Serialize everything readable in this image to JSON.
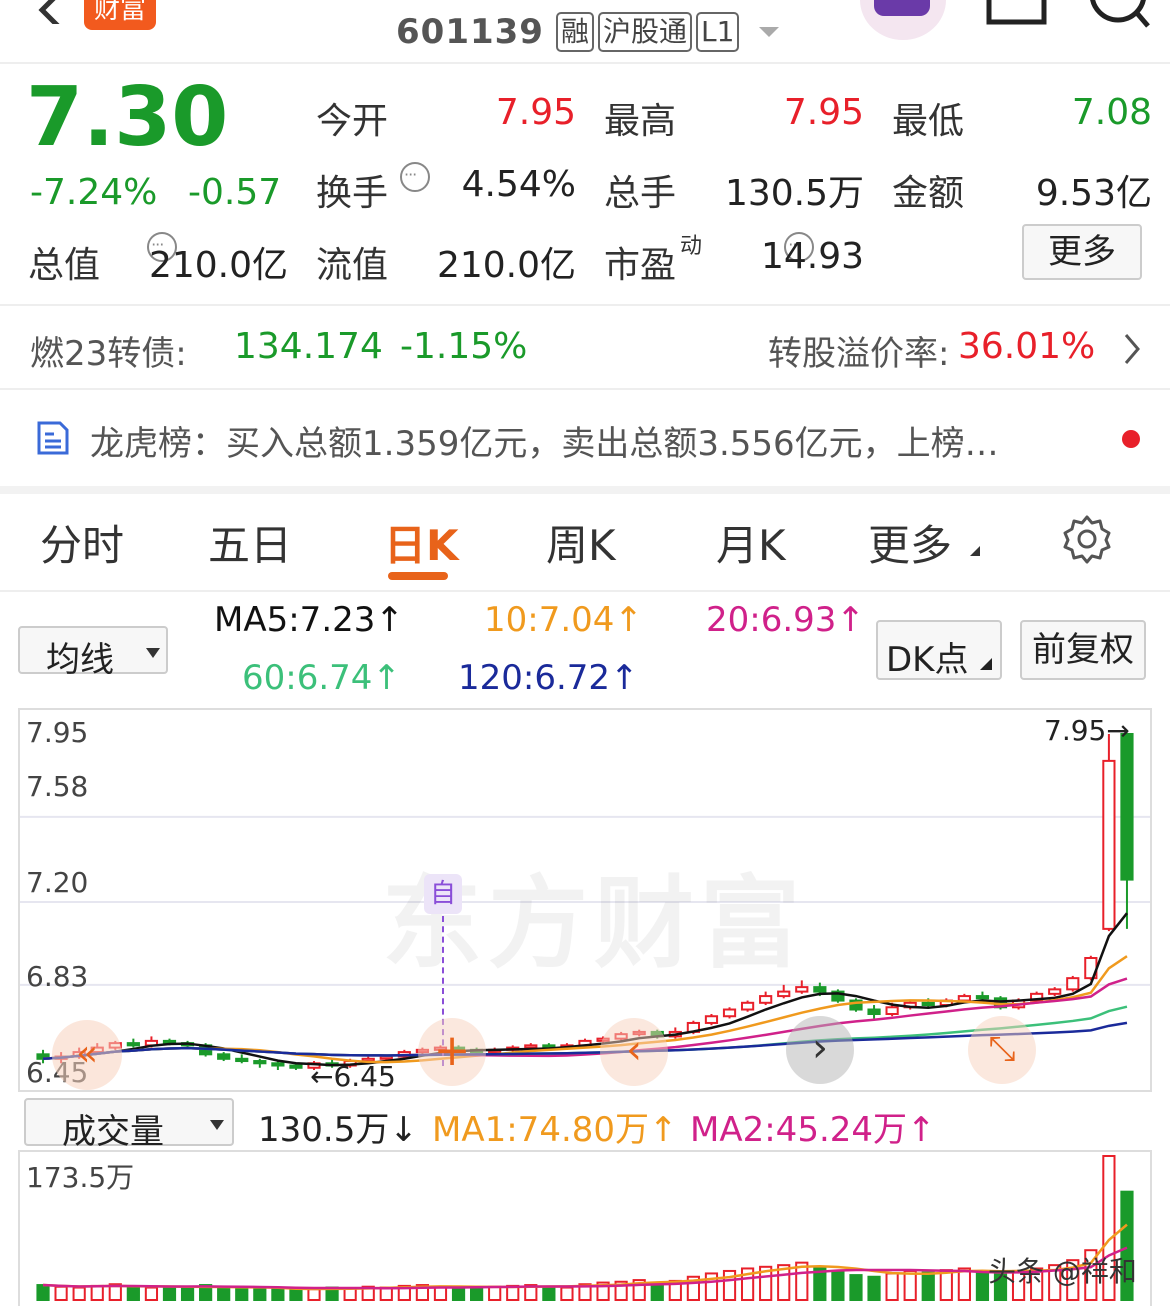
{
  "header": {
    "back_icon": "chevron-left-icon",
    "brand_badge": "财富",
    "stock_code": "601139",
    "tags": [
      "融",
      "沪股通",
      "L1"
    ],
    "dropdown_icon": "caret-down-icon",
    "share_icon": "share-icon",
    "search_icon": "search-icon"
  },
  "quote": {
    "price": "7.30",
    "change_pct": "-7.24%",
    "change_amt": "-0.57",
    "rows": [
      [
        {
          "label": "今开",
          "value": "7.95",
          "color": "red"
        },
        {
          "label": "最高",
          "value": "7.95",
          "color": "red"
        },
        {
          "label": "最低",
          "value": "7.08",
          "color": "green"
        }
      ],
      [
        {
          "label": "换手",
          "value": "4.54%",
          "color": "dark",
          "info": true
        },
        {
          "label": "总手",
          "value": "130.5万",
          "color": "dark"
        },
        {
          "label": "金额",
          "value": "9.53亿",
          "color": "dark"
        }
      ]
    ],
    "row3": {
      "mv_label": "总值",
      "mv_value": "210.0亿",
      "float_label": "流值",
      "float_value": "210.0亿",
      "pe_label": "市盈",
      "pe_sup": "动",
      "pe_value": "14.93",
      "more_button": "更多"
    }
  },
  "bond": {
    "name": "燃23转债:",
    "price": "134.174",
    "change": "-1.15%",
    "premium_label": "转股溢价率:",
    "premium_value": "36.01%"
  },
  "lhb": {
    "text": "龙虎榜：买入总额1.359亿元，卖出总额3.556亿元，上榜…"
  },
  "tabs": [
    {
      "label": "分时",
      "active": false
    },
    {
      "label": "五日",
      "active": false
    },
    {
      "label": "日K",
      "active": true
    },
    {
      "label": "周K",
      "active": false
    },
    {
      "label": "月K",
      "active": false
    },
    {
      "label": "更多",
      "active": false
    }
  ],
  "ma_bar": {
    "select": "均线",
    "ma5": "MA5:7.23",
    "ma10": "10:7.04",
    "ma20": "20:6.93",
    "ma60": "60:6.74",
    "ma120": "120:6.72",
    "dk_button": "DK点",
    "adjust_button": "前复权"
  },
  "kline": {
    "y_labels": [
      "7.95",
      "7.58",
      "7.20",
      "6.83",
      "6.45"
    ],
    "high_marker": "7.95",
    "low_marker": "6.45",
    "self_marker": "自",
    "watermark": "东方财富"
  },
  "volume_bar": {
    "select": "成交量",
    "vol": "130.5万",
    "ma1": "MA1:74.80万",
    "ma2": "MA2:45.24万",
    "max_label": "173.5万"
  },
  "footer_watermark": "头条 @祥和",
  "colors": {
    "up": "#e8202a",
    "down": "#1a9a2a",
    "accent": "#e8631a",
    "ma5": "#111111",
    "ma10": "#f09a1e",
    "ma20": "#d0218a",
    "ma60": "#3cc07a",
    "ma120": "#1a2a9a"
  },
  "chart_data": {
    "type": "candlestick",
    "candles": [
      [
        6.52,
        6.5,
        6.54,
        6.48
      ],
      [
        6.5,
        6.51,
        6.53,
        6.48
      ],
      [
        6.51,
        6.53,
        6.55,
        6.5
      ],
      [
        6.53,
        6.55,
        6.57,
        6.52
      ],
      [
        6.55,
        6.57,
        6.58,
        6.54
      ],
      [
        6.57,
        6.56,
        6.59,
        6.55
      ],
      [
        6.56,
        6.58,
        6.6,
        6.55
      ],
      [
        6.58,
        6.57,
        6.59,
        6.56
      ],
      [
        6.57,
        6.56,
        6.58,
        6.55
      ],
      [
        6.56,
        6.52,
        6.57,
        6.51
      ],
      [
        6.52,
        6.5,
        6.53,
        6.49
      ],
      [
        6.5,
        6.49,
        6.52,
        6.48
      ],
      [
        6.49,
        6.48,
        6.5,
        6.46
      ],
      [
        6.48,
        6.47,
        6.49,
        6.45
      ],
      [
        6.47,
        6.46,
        6.48,
        6.45
      ],
      [
        6.46,
        6.48,
        6.49,
        6.45
      ],
      [
        6.48,
        6.47,
        6.5,
        6.46
      ],
      [
        6.47,
        6.49,
        6.5,
        6.46
      ],
      [
        6.49,
        6.5,
        6.51,
        6.48
      ],
      [
        6.5,
        6.51,
        6.52,
        6.49
      ],
      [
        6.51,
        6.53,
        6.54,
        6.5
      ],
      [
        6.53,
        6.54,
        6.55,
        6.52
      ],
      [
        6.54,
        6.55,
        6.56,
        6.53
      ],
      [
        6.55,
        6.54,
        6.56,
        6.53
      ],
      [
        6.54,
        6.53,
        6.55,
        6.52
      ],
      [
        6.53,
        6.54,
        6.55,
        6.52
      ],
      [
        6.54,
        6.55,
        6.56,
        6.53
      ],
      [
        6.55,
        6.56,
        6.57,
        6.54
      ],
      [
        6.56,
        6.55,
        6.57,
        6.54
      ],
      [
        6.55,
        6.56,
        6.57,
        6.54
      ],
      [
        6.56,
        6.58,
        6.59,
        6.55
      ],
      [
        6.58,
        6.59,
        6.6,
        6.57
      ],
      [
        6.59,
        6.61,
        6.62,
        6.58
      ],
      [
        6.61,
        6.62,
        6.63,
        6.6
      ],
      [
        6.62,
        6.6,
        6.63,
        6.59
      ],
      [
        6.6,
        6.62,
        6.64,
        6.59
      ],
      [
        6.62,
        6.66,
        6.67,
        6.61
      ],
      [
        6.66,
        6.69,
        6.7,
        6.65
      ],
      [
        6.69,
        6.72,
        6.73,
        6.68
      ],
      [
        6.72,
        6.75,
        6.76,
        6.71
      ],
      [
        6.75,
        6.78,
        6.8,
        6.74
      ],
      [
        6.78,
        6.8,
        6.83,
        6.77
      ],
      [
        6.8,
        6.82,
        6.85,
        6.79
      ],
      [
        6.82,
        6.8,
        6.84,
        6.78
      ],
      [
        6.8,
        6.76,
        6.81,
        6.75
      ],
      [
        6.76,
        6.72,
        6.77,
        6.71
      ],
      [
        6.72,
        6.7,
        6.74,
        6.68
      ],
      [
        6.7,
        6.73,
        6.75,
        6.69
      ],
      [
        6.73,
        6.75,
        6.76,
        6.72
      ],
      [
        6.75,
        6.74,
        6.77,
        6.73
      ],
      [
        6.74,
        6.76,
        6.77,
        6.73
      ],
      [
        6.76,
        6.78,
        6.79,
        6.75
      ],
      [
        6.78,
        6.77,
        6.8,
        6.76
      ],
      [
        6.77,
        6.73,
        6.78,
        6.72
      ],
      [
        6.73,
        6.76,
        6.77,
        6.72
      ],
      [
        6.76,
        6.79,
        6.8,
        6.75
      ],
      [
        6.79,
        6.81,
        6.82,
        6.78
      ],
      [
        6.81,
        6.86,
        6.87,
        6.8
      ],
      [
        6.86,
        6.95,
        6.96,
        6.85
      ],
      [
        7.08,
        7.83,
        7.95,
        7.07
      ],
      [
        7.95,
        7.3,
        7.95,
        7.08
      ]
    ],
    "volumes": [
      18,
      16,
      15,
      17,
      19,
      16,
      15,
      14,
      16,
      18,
      15,
      14,
      13,
      14,
      12,
      13,
      15,
      14,
      16,
      15,
      17,
      18,
      16,
      15,
      14,
      16,
      17,
      18,
      16,
      15,
      19,
      21,
      22,
      24,
      20,
      23,
      28,
      32,
      35,
      38,
      40,
      42,
      45,
      38,
      34,
      30,
      28,
      32,
      35,
      33,
      36,
      38,
      34,
      32,
      35,
      38,
      42,
      48,
      60,
      173.5,
      130.5
    ],
    "y_range": [
      6.45,
      7.95
    ],
    "vol_max": 173.5
  }
}
